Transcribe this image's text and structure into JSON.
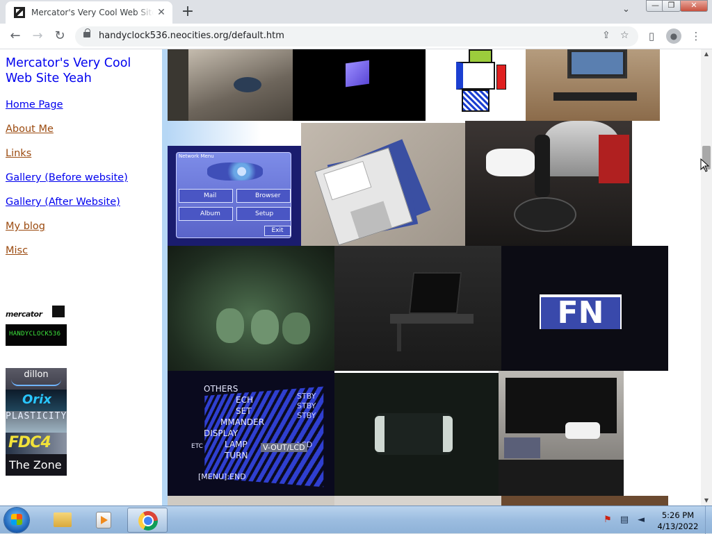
{
  "browser": {
    "tab_title": "Mercator's Very Cool Web Site Yeah",
    "tab_close": "✕",
    "new_tab": "+",
    "url": "handyclock536.neocities.org/default.htm",
    "back": "←",
    "forward": "→",
    "reload": "↻",
    "tab_search": "⌄",
    "win_min": "—",
    "win_restore": "❐",
    "win_close": "✕",
    "share_icon": "⇪",
    "star_icon": "☆",
    "sidepanel_icon": "▯",
    "profile_icon": "●",
    "menu_icon": "⋮"
  },
  "site": {
    "title": "Mercator's Very Cool Web Site Yeah",
    "nav": [
      {
        "label": "Home Page",
        "color": "#0000ee"
      },
      {
        "label": "About Me",
        "color": "#9b4a0f"
      },
      {
        "label": "Links",
        "color": "#9b4a0f"
      },
      {
        "label": "Gallery (Before website)",
        "color": "#0000ee"
      },
      {
        "label": "Gallery (After Website)",
        "color": "#0000ee"
      },
      {
        "label": "My blog",
        "color": "#9b4a0f"
      },
      {
        "label": "Misc",
        "color": "#9b4a0f"
      }
    ],
    "badges": {
      "mercator": "mercator",
      "handyclock": "HANDYCLOCK536",
      "dillon": "dillon",
      "orix": "Orix",
      "plastic": "PLASTICITY",
      "fdc": "FDC4",
      "zone": "The Zone"
    }
  },
  "gallery": {
    "network_menu": {
      "title": "Network Menu",
      "buttons": [
        "Mail",
        "Browser",
        "Album",
        "Setup"
      ],
      "exit": "Exit"
    },
    "fn_label": "FN",
    "lcd_menu": {
      "items": [
        "OTHERS",
        "ECH",
        "SET",
        "MMANDER",
        "DISPLAY",
        "LAMP",
        "TURN",
        "ETC"
      ],
      "right": [
        "STBY",
        "STBY",
        "STBY",
        "LCD"
      ],
      "vout": "V-OUT/LCD",
      "footer": "[MENU]:END"
    }
  },
  "taskbar": {
    "time": "5:26 PM",
    "date": "4/13/2022"
  }
}
